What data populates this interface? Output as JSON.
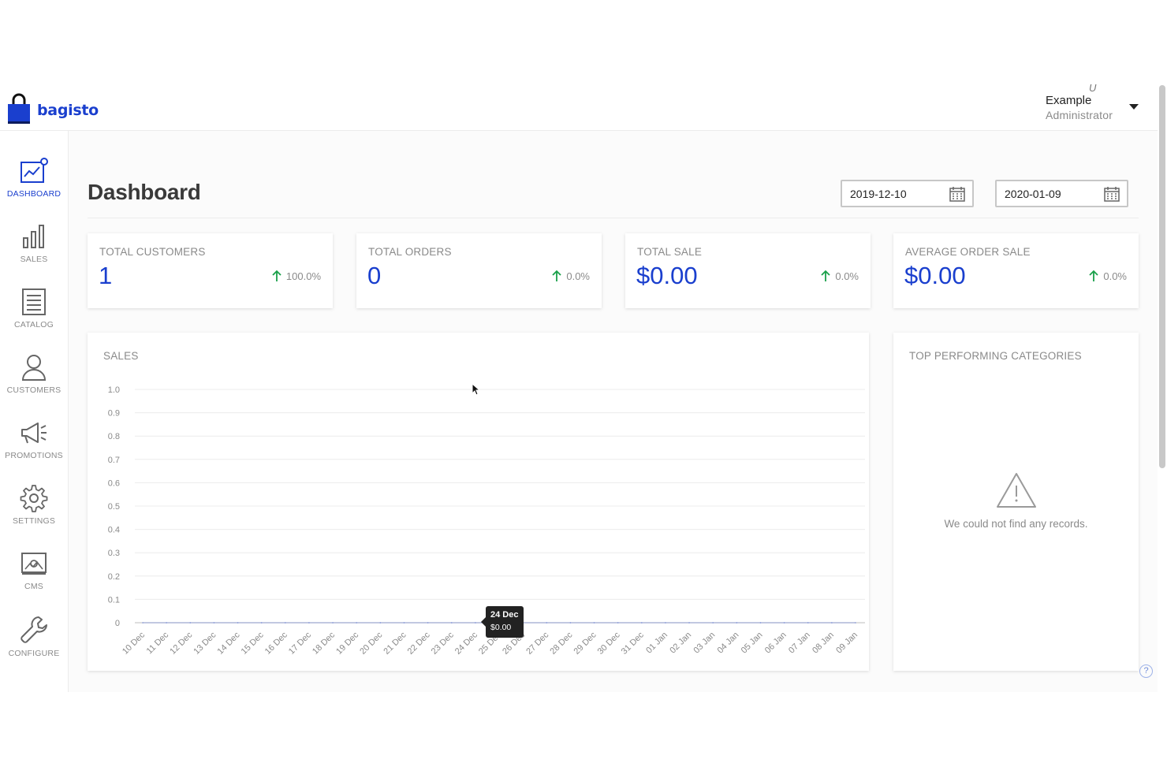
{
  "brand": {
    "name": "bagisto",
    "accent": "#1a3fce"
  },
  "profile": {
    "name": "Example",
    "role": "Administrator",
    "hint": "U"
  },
  "sidebar": {
    "items": [
      {
        "label": "DASHBOARD",
        "icon": "dashboard-icon",
        "active": true
      },
      {
        "label": "SALES",
        "icon": "bar-chart-icon",
        "active": false
      },
      {
        "label": "CATALOG",
        "icon": "catalog-list-icon",
        "active": false
      },
      {
        "label": "CUSTOMERS",
        "icon": "user-icon",
        "active": false
      },
      {
        "label": "PROMOTIONS",
        "icon": "megaphone-icon",
        "active": false
      },
      {
        "label": "SETTINGS",
        "icon": "gear-icon",
        "active": false
      },
      {
        "label": "CMS",
        "icon": "cms-icon",
        "active": false
      },
      {
        "label": "CONFIGURE",
        "icon": "wrench-icon",
        "active": false
      }
    ]
  },
  "page": {
    "title": "Dashboard",
    "start_date": "2019-12-10",
    "end_date": "2020-01-09"
  },
  "stats": [
    {
      "label": "TOTAL CUSTOMERS",
      "value": "1",
      "change": "100.0%"
    },
    {
      "label": "TOTAL ORDERS",
      "value": "0",
      "change": "0.0%"
    },
    {
      "label": "TOTAL SALE",
      "value": "$0.00",
      "change": "0.0%"
    },
    {
      "label": "AVERAGE ORDER SALE",
      "value": "$0.00",
      "change": "0.0%"
    }
  ],
  "sales_chart": {
    "heading": "SALES",
    "tooltip": {
      "title": "24 Dec",
      "value": "$0.00"
    }
  },
  "chart_data": {
    "type": "line",
    "title": "SALES",
    "xlabel": "",
    "ylabel": "",
    "ylim": [
      0,
      1.0
    ],
    "yticks": [
      "0",
      "0.1",
      "0.2",
      "0.3",
      "0.4",
      "0.5",
      "0.6",
      "0.7",
      "0.8",
      "0.9",
      "1.0"
    ],
    "categories": [
      "10 Dec",
      "11 Dec",
      "12 Dec",
      "13 Dec",
      "14 Dec",
      "15 Dec",
      "16 Dec",
      "17 Dec",
      "18 Dec",
      "19 Dec",
      "20 Dec",
      "21 Dec",
      "22 Dec",
      "23 Dec",
      "24 Dec",
      "25 Dec",
      "26 Dec",
      "27 Dec",
      "28 Dec",
      "29 Dec",
      "30 Dec",
      "31 Dec",
      "01 Jan",
      "02 Jan",
      "03 Jan",
      "04 Jan",
      "05 Jan",
      "06 Jan",
      "07 Jan",
      "08 Jan",
      "09 Jan"
    ],
    "series": [
      {
        "values": [
          0,
          0,
          0,
          0,
          0,
          0,
          0,
          0,
          0,
          0,
          0,
          0,
          0,
          0,
          0,
          0,
          0,
          0,
          0,
          0,
          0,
          0,
          0,
          0,
          0,
          0,
          0,
          0,
          0,
          0,
          0
        ]
      }
    ],
    "grid": true
  },
  "categories_card": {
    "heading": "TOP PERFORMING CATEGORIES",
    "empty_text": "We could not find any records."
  },
  "colors": {
    "positive": "#1aa04a",
    "muted": "#8a8a8a",
    "tooltip_bg": "#222222"
  },
  "help": {
    "glyph": "?"
  }
}
